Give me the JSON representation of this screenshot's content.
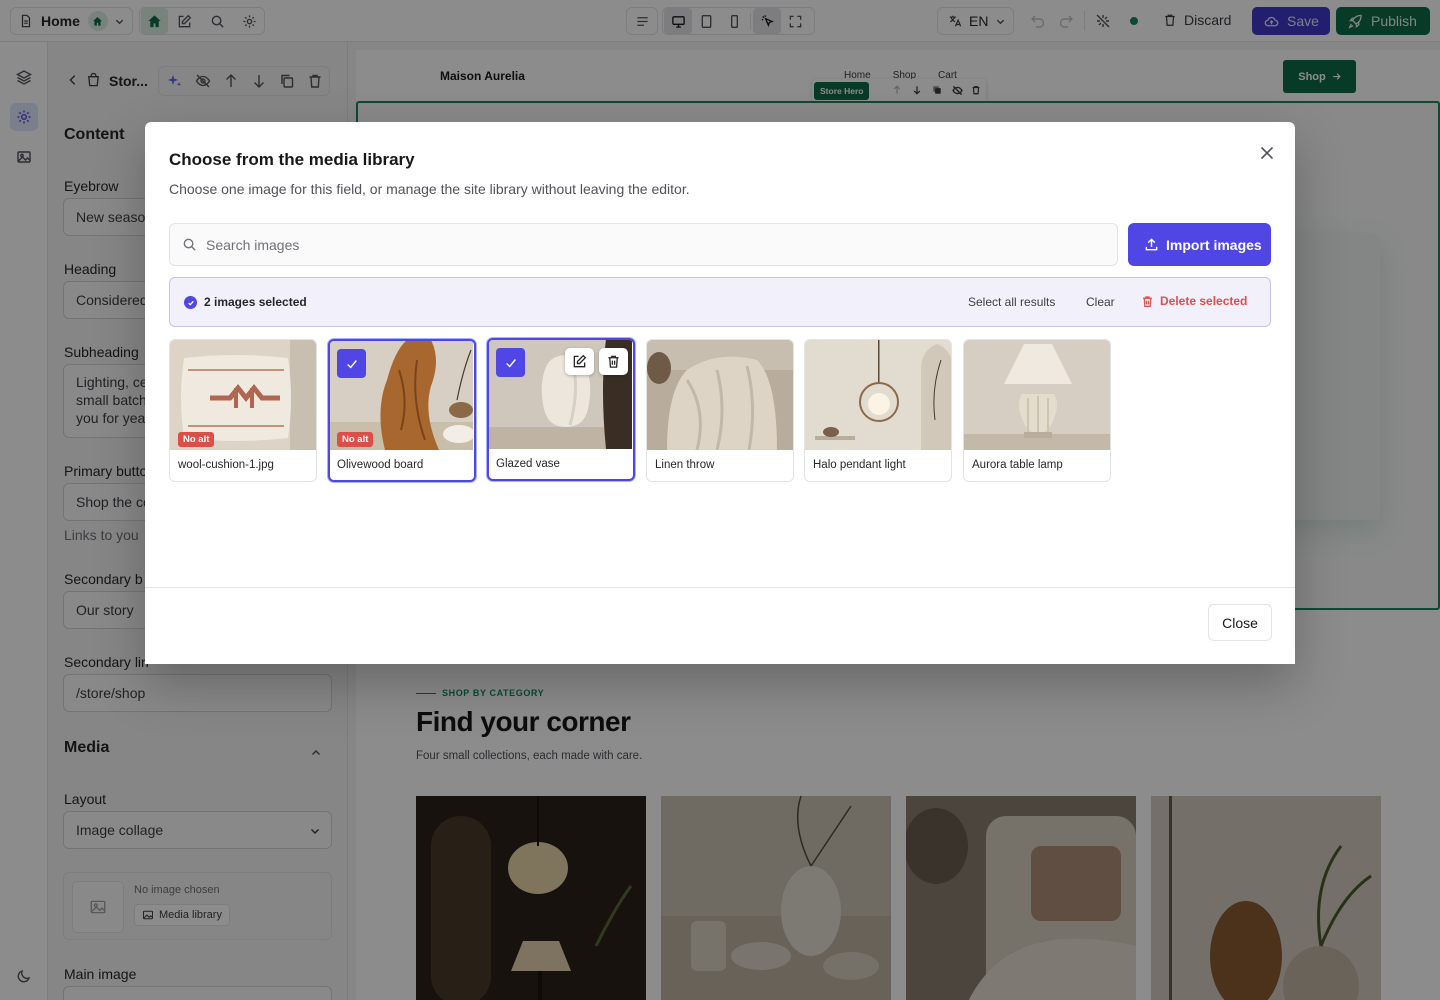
{
  "topbar": {
    "page_label": "Home",
    "language": "EN",
    "discard_label": "Discard",
    "save_label": "Save",
    "publish_label": "Publish"
  },
  "panel": {
    "breadcrumb": "Stor...",
    "content_heading": "Content",
    "fields": {
      "eyebrow_label": "Eyebrow",
      "eyebrow_value": "New seaso",
      "heading_label": "Heading",
      "heading_value": "Considered",
      "subheading_label": "Subheading",
      "subheading_lines": [
        "Lighting, ce",
        "small batch",
        "you for yea"
      ],
      "primary_label": "Primary butto",
      "primary_value": "Shop the co",
      "primary_hint": "Links to you",
      "secondary_label": "Secondary b",
      "secondary_value": "Our story",
      "secondary_link_label": "Secondary lin",
      "secondary_link_value": "/store/shop"
    },
    "media_heading": "Media",
    "layout_label": "Layout",
    "layout_value": "Image collage",
    "no_image_text": "No image chosen",
    "media_library_label": "Media library",
    "main_image_label": "Main image"
  },
  "canvas": {
    "brand": "Maison Aurelia",
    "nav": [
      "Home",
      "Shop",
      "Cart"
    ],
    "shop_button": "Shop",
    "section_tag": "Store Hero",
    "category_eyebrow": "SHOP BY CATEGORY",
    "category_title": "Find your corner",
    "category_subtitle": "Four small collections, each made with care."
  },
  "modal": {
    "title": "Choose from the media library",
    "subtitle": "Choose one image for this field, or manage the site library without leaving the editor.",
    "search_placeholder": "Search images",
    "import_label": "Import images",
    "selection_count": "2 images selected",
    "select_all_label": "Select all results",
    "clear_label": "Clear",
    "delete_selected_label": "Delete selected",
    "close_label": "Close",
    "no_alt_badge": "No alt",
    "images": [
      {
        "name": "wool-cushion-1.jpg",
        "selected": false,
        "no_alt": true
      },
      {
        "name": "Olivewood board",
        "selected": true,
        "no_alt": true
      },
      {
        "name": "Glazed vase",
        "selected": true,
        "no_alt": false
      },
      {
        "name": "Linen throw",
        "selected": false,
        "no_alt": false
      },
      {
        "name": "Halo pendant light",
        "selected": false,
        "no_alt": false
      },
      {
        "name": "Aurora table lamp",
        "selected": false,
        "no_alt": false
      }
    ]
  },
  "colors": {
    "accent": "#4f46e5",
    "publish_green": "#0f6b4a",
    "danger": "#dc4f49"
  }
}
